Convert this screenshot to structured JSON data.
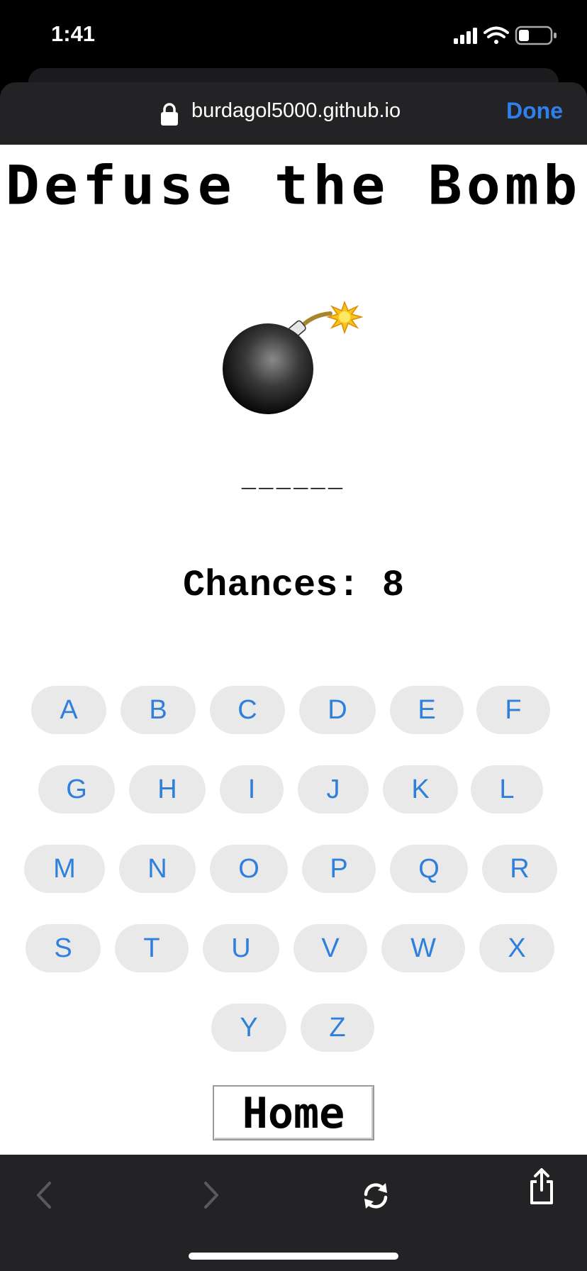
{
  "status_bar": {
    "time": "1:41",
    "icons": [
      "signal-icon",
      "wifi-icon",
      "battery-icon"
    ]
  },
  "browser": {
    "url": "burdagol5000.github.io",
    "done_label": "Done",
    "accent_color": "#2f80ed"
  },
  "game": {
    "title": "Defuse the Bomb",
    "word_display": "______",
    "chances_label": "Chances:",
    "chances_value": "8",
    "home_label": "Home",
    "key_color": "#2f7fdc",
    "key_bg": "#e9e9e9"
  },
  "keyboard": {
    "rows": [
      [
        "A",
        "B",
        "C",
        "D",
        "E",
        "F"
      ],
      [
        "G",
        "H",
        "I",
        "J",
        "K",
        "L"
      ],
      [
        "M",
        "N",
        "O",
        "P",
        "Q",
        "R"
      ],
      [
        "S",
        "T",
        "U",
        "V",
        "W",
        "X"
      ],
      [
        "Y",
        "Z"
      ]
    ]
  },
  "toolbar": {
    "icons": [
      "back-icon",
      "forward-icon",
      "reload-icon",
      "share-icon"
    ]
  }
}
